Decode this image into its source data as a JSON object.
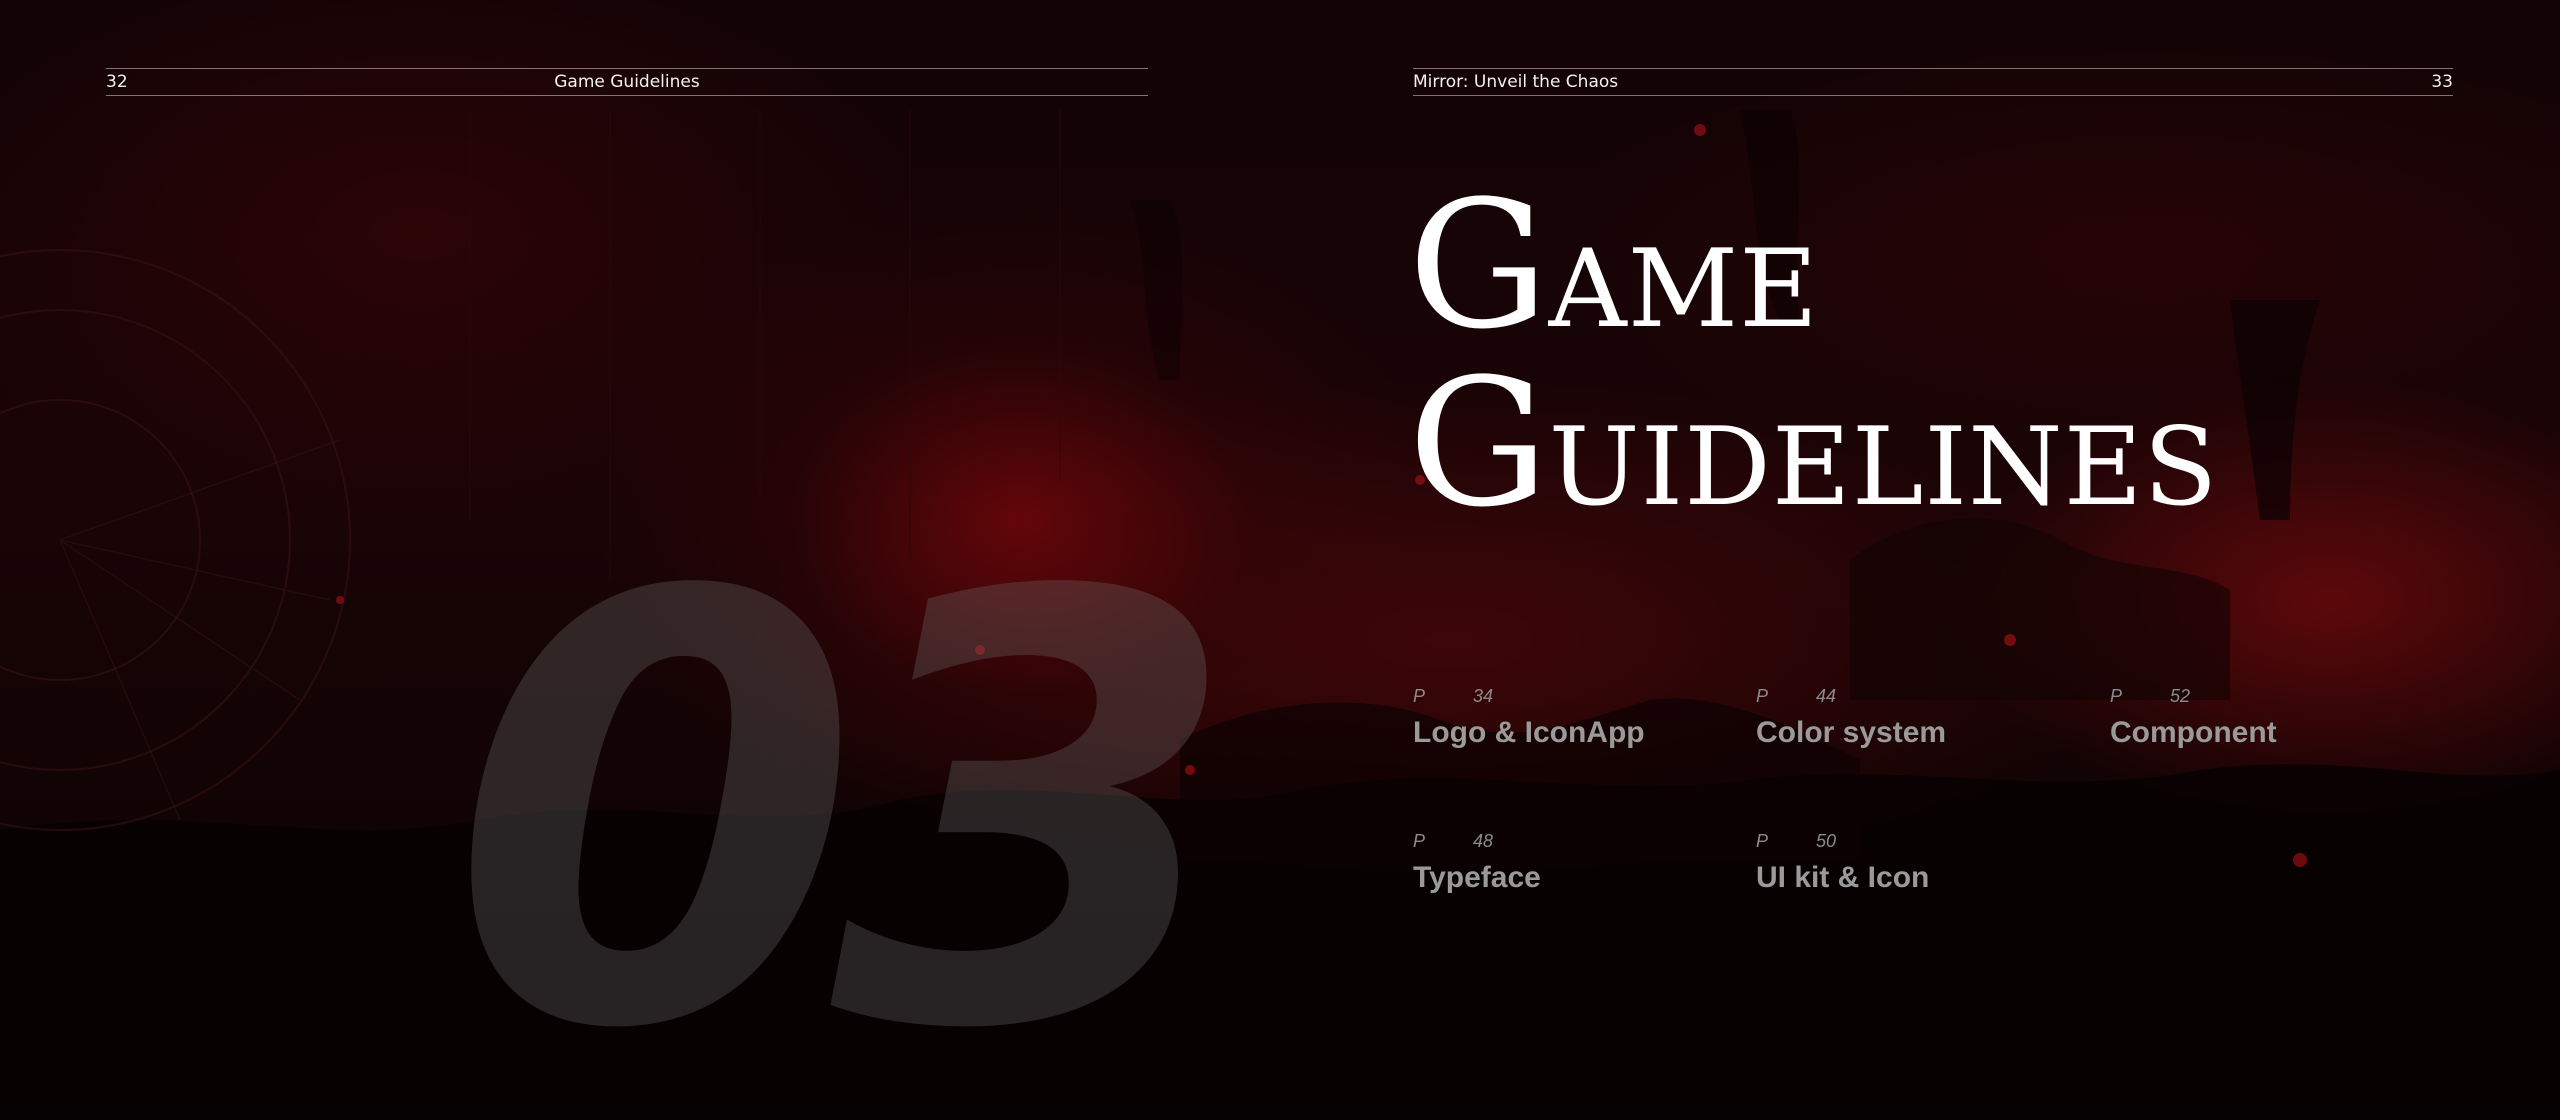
{
  "left_page": {
    "page_number": "32",
    "running_title": "Game Guidelines",
    "chapter_number": "03"
  },
  "right_page": {
    "page_number": "33",
    "running_title": "Mirror: Unveil the Chaos",
    "title_line1": {
      "cap": "G",
      "rest": "AME"
    },
    "title_line2": {
      "cap": "G",
      "rest": "UIDELINES"
    }
  },
  "toc": [
    {
      "prefix": "P",
      "page": "34",
      "label": "Logo & IconApp"
    },
    {
      "prefix": "P",
      "page": "44",
      "label": "Color system"
    },
    {
      "prefix": "P",
      "page": "52",
      "label": "Component"
    },
    {
      "prefix": "P",
      "page": "48",
      "label": "Typeface"
    },
    {
      "prefix": "P",
      "page": "50",
      "label": "UI kit & Icon"
    }
  ],
  "colors": {
    "background": "#0a0203",
    "accent_red": "#78060a",
    "text_primary": "#ffffff",
    "text_muted": "#9a9a9a"
  }
}
